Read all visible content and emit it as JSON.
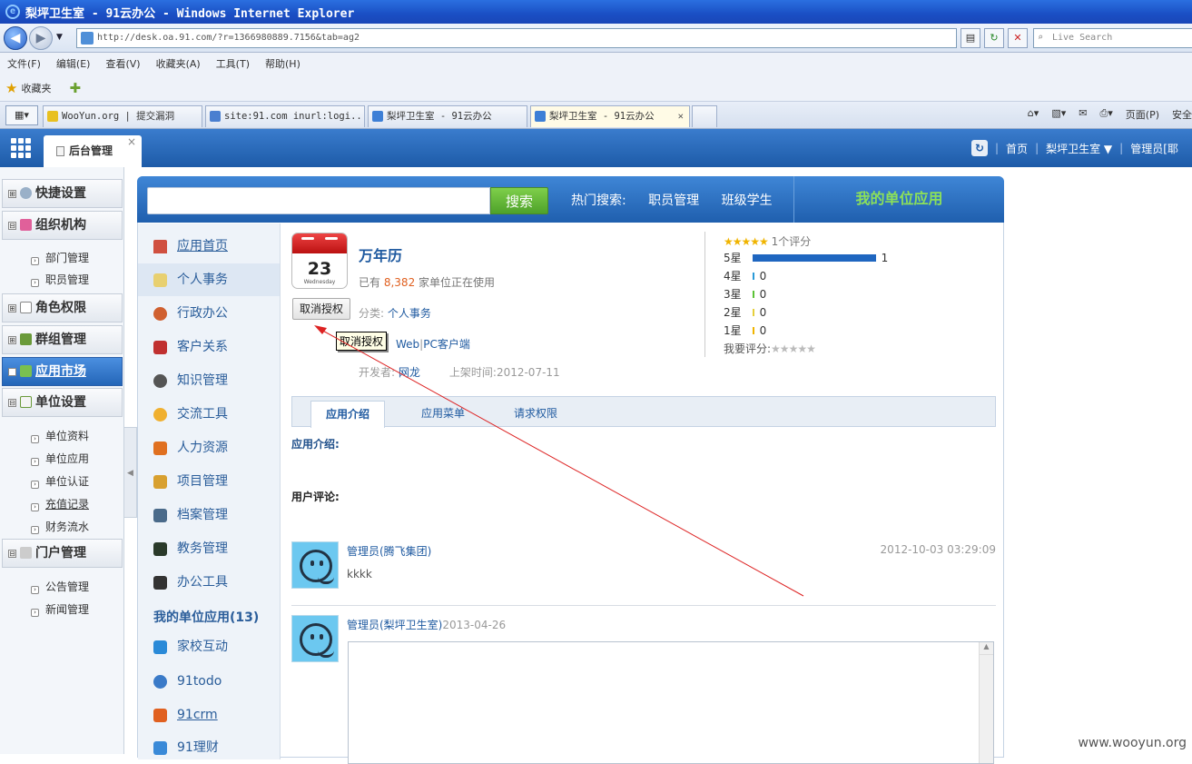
{
  "browser": {
    "title": "梨坪卫生室 - 91云办公 - Windows Internet Explorer",
    "url": "http://desk.oa.91.com/?r=1366980889.7156&tab=ag2",
    "search_placeholder": "Live Search",
    "menu": [
      "文件(F)",
      "编辑(E)",
      "查看(V)",
      "收藏夹(A)",
      "工具(T)",
      "帮助(H)"
    ],
    "favorites": "收藏夹",
    "tabs": [
      {
        "label": "WooYun.org | 提交漏洞",
        "active": false
      },
      {
        "label": "site:91.com inurl:logi...",
        "active": false
      },
      {
        "label": "梨坪卫生室 - 91云办公",
        "active": false
      },
      {
        "label": "梨坪卫生室 - 91云办公",
        "active": true
      }
    ],
    "right_tools": [
      "页面(P)",
      "安全"
    ]
  },
  "header": {
    "tab_label": "后台管理",
    "home": "首页",
    "org": "梨坪卫生室 ▼",
    "user": "管理员[耶"
  },
  "sidebar": {
    "groups": [
      {
        "label": "快捷设置",
        "toggle": "⊞"
      },
      {
        "label": "组织机构",
        "toggle": "⊟"
      },
      {
        "label": "角色权限",
        "toggle": "⊞"
      },
      {
        "label": "群组管理",
        "toggle": "⊞"
      },
      {
        "label": "应用市场",
        "toggle": "⊞"
      },
      {
        "label": "单位设置",
        "toggle": "⊟"
      },
      {
        "label": "门户管理",
        "toggle": "⊟"
      }
    ],
    "org_items": [
      "部门管理",
      "职员管理"
    ],
    "unit_items": [
      "单位资料",
      "单位应用",
      "单位认证",
      "充值记录",
      "财务流水"
    ],
    "portal_items": [
      "公告管理",
      "新闻管理"
    ]
  },
  "search": {
    "button": "搜索",
    "hot_label": "热门搜索:",
    "hot_terms": [
      "职员管理",
      "班级学生"
    ],
    "my_apps": "我的单位应用"
  },
  "inner_nav": [
    "应用首页",
    "个人事务",
    "行政办公",
    "客户关系",
    "知识管理",
    "交流工具",
    "人力资源",
    "项目管理",
    "档案管理",
    "教务管理",
    "办公工具"
  ],
  "my_unit": {
    "title": "我的单位应用(13)",
    "items": [
      "家校互动",
      "91todo",
      "91crm",
      "91理财"
    ]
  },
  "app": {
    "name": "万年历",
    "icon_day": "23",
    "icon_weekday": "Wednesday",
    "users_prefix": "已有",
    "users_count": "8,382",
    "users_suffix": "家单位正在使用",
    "revoke_button": "取消授权",
    "category_label": "分类:",
    "category": "个人事务",
    "tooltip": "取消授权",
    "platform_web": "Web",
    "platform_pc": "PC客户端",
    "developer_label": "开发者:",
    "developer": "网龙",
    "release_label": "上架时间:",
    "release_date": "2012-07-11"
  },
  "rating": {
    "summary": "1个评分",
    "rows": [
      {
        "label": "5星",
        "count": "1",
        "fraction": 1.0,
        "color": "#1f66c0"
      },
      {
        "label": "4星",
        "count": "0",
        "fraction": 0,
        "color": "#2a9ad8"
      },
      {
        "label": "3星",
        "count": "0",
        "fraction": 0,
        "color": "#5bc236"
      },
      {
        "label": "2星",
        "count": "0",
        "fraction": 0,
        "color": "#e6cf3c"
      },
      {
        "label": "1星",
        "count": "0",
        "fraction": 0,
        "color": "#f0b400"
      }
    ],
    "my_rating_label": "我要评分:"
  },
  "tabs": [
    "应用介绍",
    "应用菜单",
    "请求权限"
  ],
  "intro_title": "应用介绍:",
  "comments_title": "用户评论:",
  "comments": [
    {
      "user": "管理员(腾飞集团)",
      "date": "2012-10-03 03:29:09",
      "text": "kkkk"
    },
    {
      "user": "管理员(梨坪卫生室)",
      "date": "2013-04-26"
    }
  ],
  "watermark": "www.wooyun.org"
}
